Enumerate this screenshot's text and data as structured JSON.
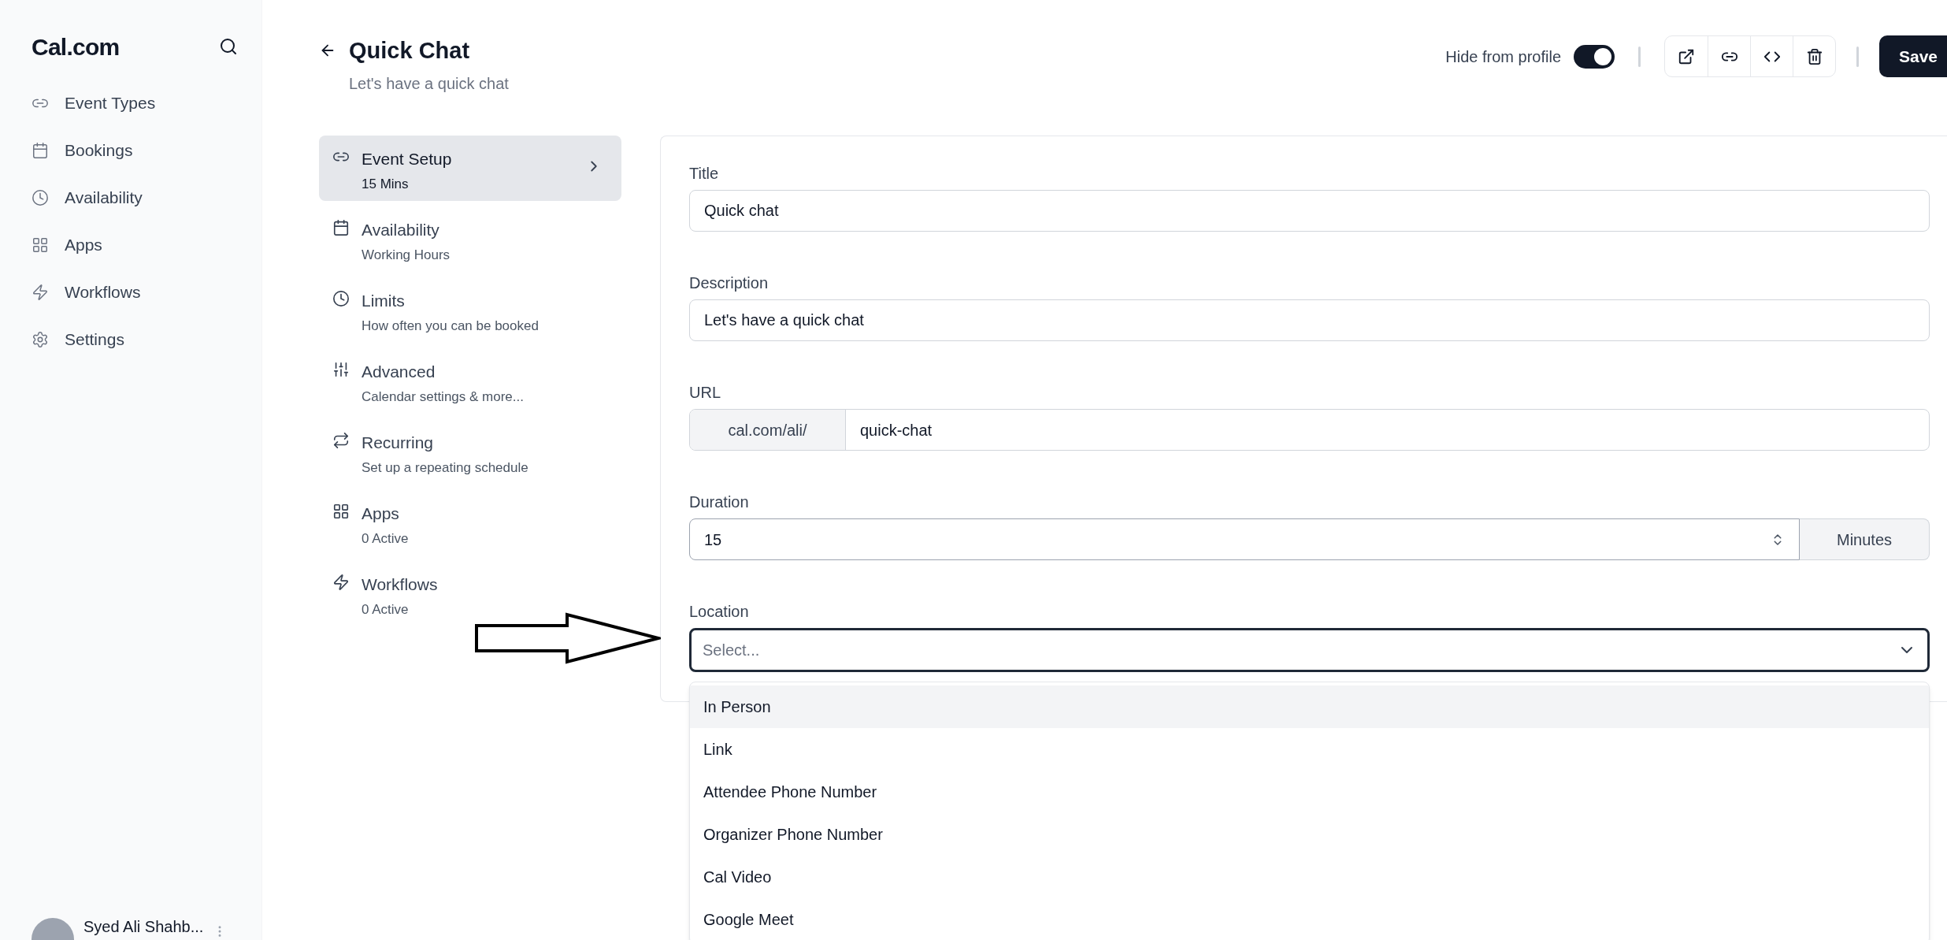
{
  "sidebar": {
    "logo": "Cal.com",
    "nav": [
      {
        "label": "Event Types"
      },
      {
        "label": "Bookings"
      },
      {
        "label": "Availability"
      },
      {
        "label": "Apps"
      },
      {
        "label": "Workflows"
      },
      {
        "label": "Settings"
      }
    ],
    "user": {
      "name": "Syed Ali Shahb..."
    }
  },
  "header": {
    "title": "Quick Chat",
    "subtitle": "Let's have a quick chat",
    "hide_from_profile": {
      "label": "Hide from profile",
      "on": true
    },
    "save": "Save"
  },
  "menu": [
    {
      "title": "Event Setup",
      "subtitle": "15 Mins",
      "selected": true
    },
    {
      "title": "Availability",
      "subtitle": "Working Hours",
      "selected": false
    },
    {
      "title": "Limits",
      "subtitle": "How often you can be booked",
      "selected": false
    },
    {
      "title": "Advanced",
      "subtitle": "Calendar settings & more...",
      "selected": false
    },
    {
      "title": "Recurring",
      "subtitle": "Set up a repeating schedule",
      "selected": false
    },
    {
      "title": "Apps",
      "subtitle": "0 Active",
      "selected": false
    },
    {
      "title": "Workflows",
      "subtitle": "0 Active",
      "selected": false
    }
  ],
  "form": {
    "title": {
      "label": "Title",
      "value": "Quick chat"
    },
    "description": {
      "label": "Description",
      "value": "Let's have a quick chat"
    },
    "url": {
      "label": "URL",
      "prefix": "cal.com/ali/",
      "value": "quick-chat"
    },
    "duration": {
      "label": "Duration",
      "value": "15",
      "unit": "Minutes"
    },
    "location": {
      "label": "Location",
      "placeholder": "Select...",
      "expanded": true,
      "options": [
        {
          "label": "In Person",
          "selected": true
        },
        {
          "label": "Link",
          "selected": false
        },
        {
          "label": "Attendee Phone Number",
          "selected": false
        },
        {
          "label": "Organizer Phone Number",
          "selected": false
        },
        {
          "label": "Cal Video",
          "selected": false
        },
        {
          "label": "Google Meet",
          "selected": false
        }
      ]
    }
  }
}
